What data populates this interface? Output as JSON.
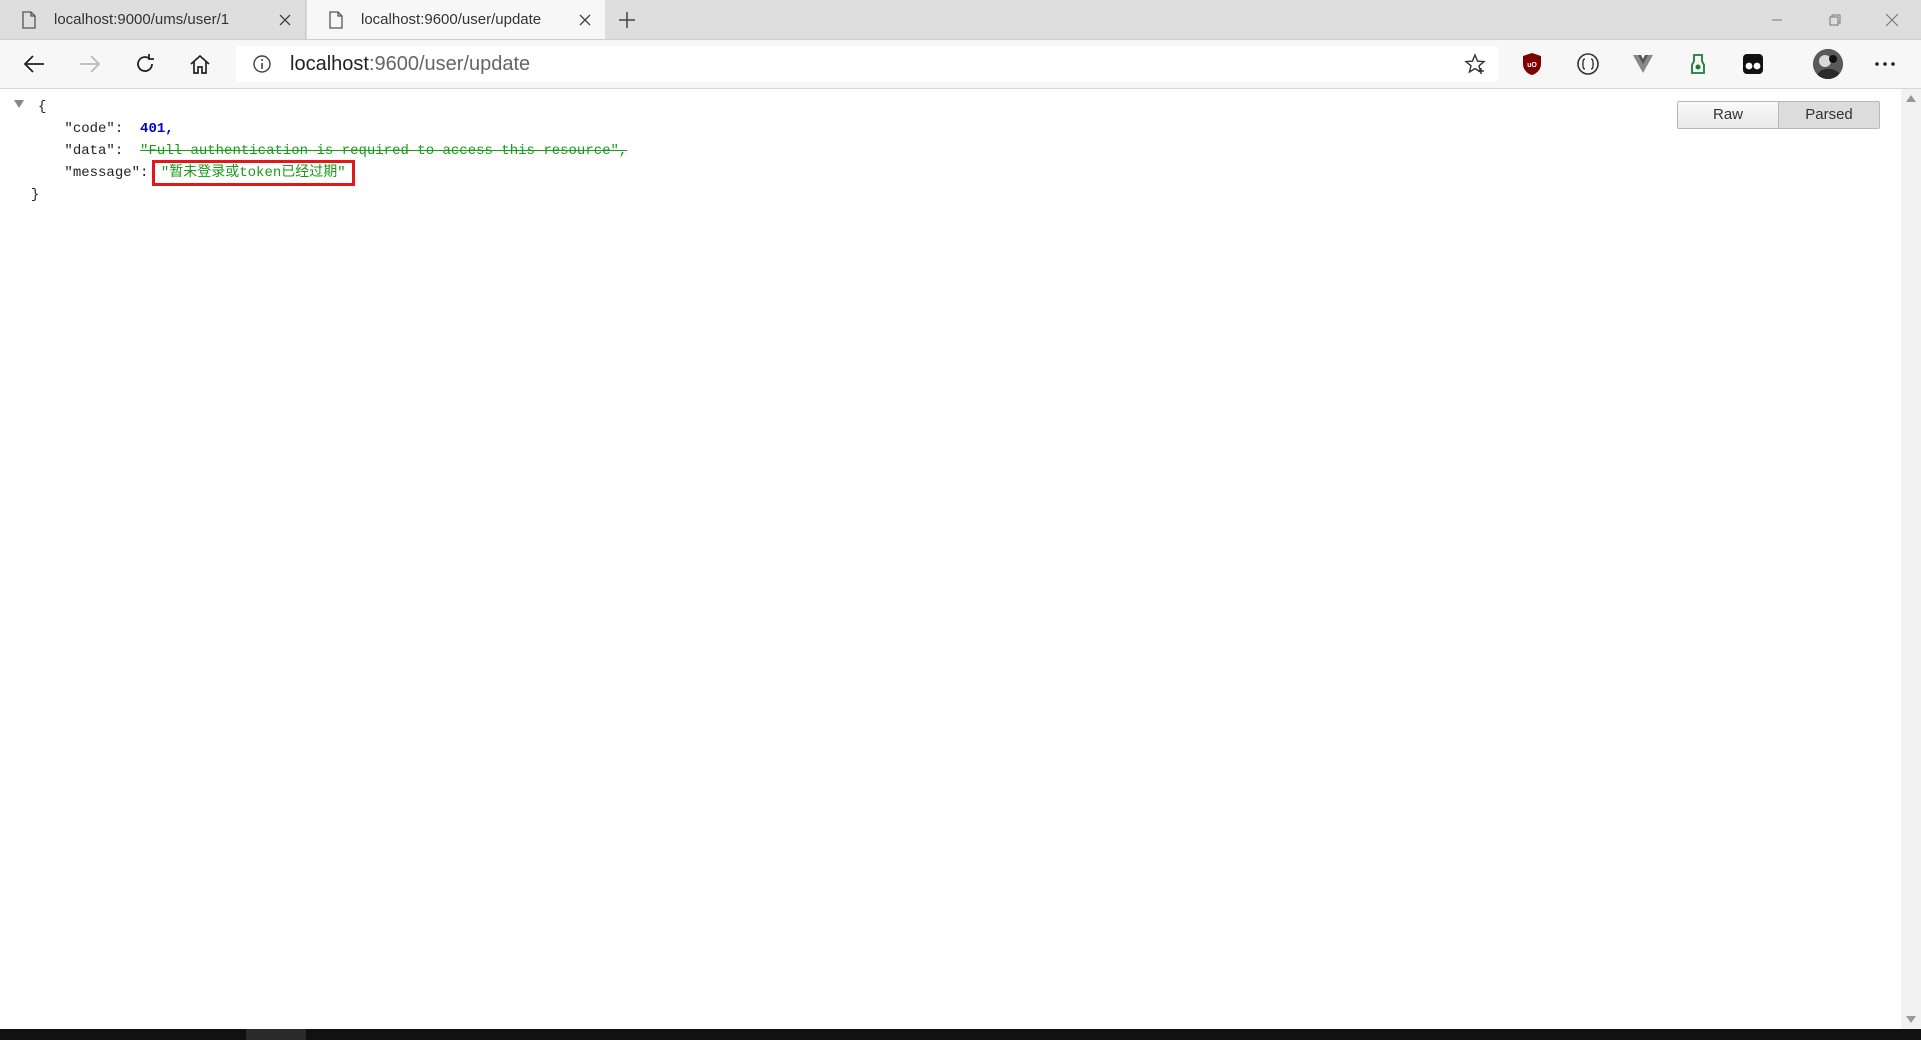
{
  "tabs": [
    {
      "title": "localhost:9000/ums/user/1"
    },
    {
      "title": "localhost:9600/user/update"
    }
  ],
  "address": {
    "host": "localhost",
    "rest": ":9600/user/update"
  },
  "viewer": {
    "raw_label": "Raw",
    "parsed_label": "Parsed"
  },
  "json": {
    "open_brace": "{",
    "close_brace": "}",
    "code_key": "\"code\":",
    "code_value": "401,",
    "data_key": "\"data\":",
    "data_value": "\"Full authentication is required to access this resource\",",
    "message_key": "\"message\":",
    "message_value": "\"暂未登录或token已经过期\""
  },
  "colors": {
    "highlight": "#e01818",
    "string": "#1a9a1a",
    "number": "#0000cc"
  }
}
